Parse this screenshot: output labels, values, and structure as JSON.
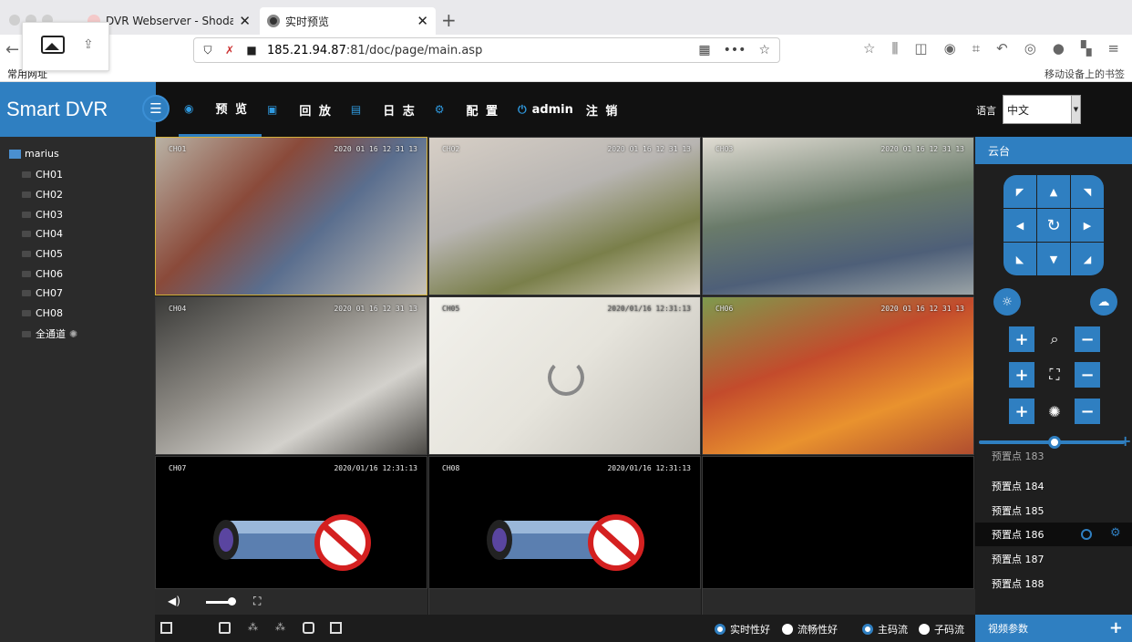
{
  "browser": {
    "tabs": [
      {
        "label": "DVR Webserver - Shodan Search"
      },
      {
        "label": "实时预览"
      }
    ],
    "url_host": "185.21.94.87",
    "url_path": ":81/doc/page/main.asp",
    "bookmarks_left": "常用网址",
    "bookmarks_right": "移动设备上的书签"
  },
  "app": {
    "brand": "Smart DVR",
    "menu": [
      {
        "label": "预 览",
        "icon": "eye-icon",
        "active": true
      },
      {
        "label": "回 放",
        "icon": "play-icon"
      },
      {
        "label": "日 志",
        "icon": "log-icon"
      },
      {
        "label": "配 置",
        "icon": "gear-icon"
      },
      {
        "label": "admin",
        "icon": "power-icon"
      },
      {
        "label": "注 销"
      }
    ],
    "language_label": "语言",
    "language_value": "中文"
  },
  "sidebar": {
    "root": "marius",
    "channels": [
      "CH01",
      "CH02",
      "CH03",
      "CH04",
      "CH05",
      "CH06",
      "CH07",
      "CH08"
    ],
    "all_channels": "全通道"
  },
  "grid": {
    "cells": [
      {
        "label": "CH01",
        "timestamp": "2020 01 16 12 31 13",
        "state": "video"
      },
      {
        "label": "CH02",
        "timestamp": "2020 01 16 12 31 13",
        "state": "video"
      },
      {
        "label": "CH03",
        "timestamp": "2020 01 16 12 31 13",
        "state": "video"
      },
      {
        "label": "CH04",
        "timestamp": "2020 01 16 12 31 13",
        "state": "video"
      },
      {
        "label": "CH05",
        "timestamp": "2020/01/16 12:31:13",
        "state": "loading"
      },
      {
        "label": "CH06",
        "timestamp": "2020 01 16 12 31 13",
        "state": "video"
      },
      {
        "label": "CH07",
        "timestamp": "2020/01/16 12:31:13",
        "state": "no-camera"
      },
      {
        "label": "CH08",
        "timestamp": "2020/01/16 12:31:13",
        "state": "no-camera"
      },
      {
        "label": "",
        "timestamp": "",
        "state": "empty"
      }
    ]
  },
  "bottom": {
    "options": [
      {
        "label": "实时性好",
        "selected": true
      },
      {
        "label": "流畅性好",
        "selected": false
      },
      {
        "label": "主码流",
        "selected": true
      },
      {
        "label": "子码流",
        "selected": false
      }
    ]
  },
  "ptz": {
    "title": "云台",
    "presets": [
      "预置点 183",
      "预置点 184",
      "预置点 185",
      "预置点 186",
      "预置点 187",
      "预置点 188"
    ],
    "active_preset_index": 3,
    "video_params": "视频参数"
  },
  "colors": {
    "accent": "#2f7fc1",
    "topbar": "#111111",
    "panel": "#2b2b2b"
  }
}
